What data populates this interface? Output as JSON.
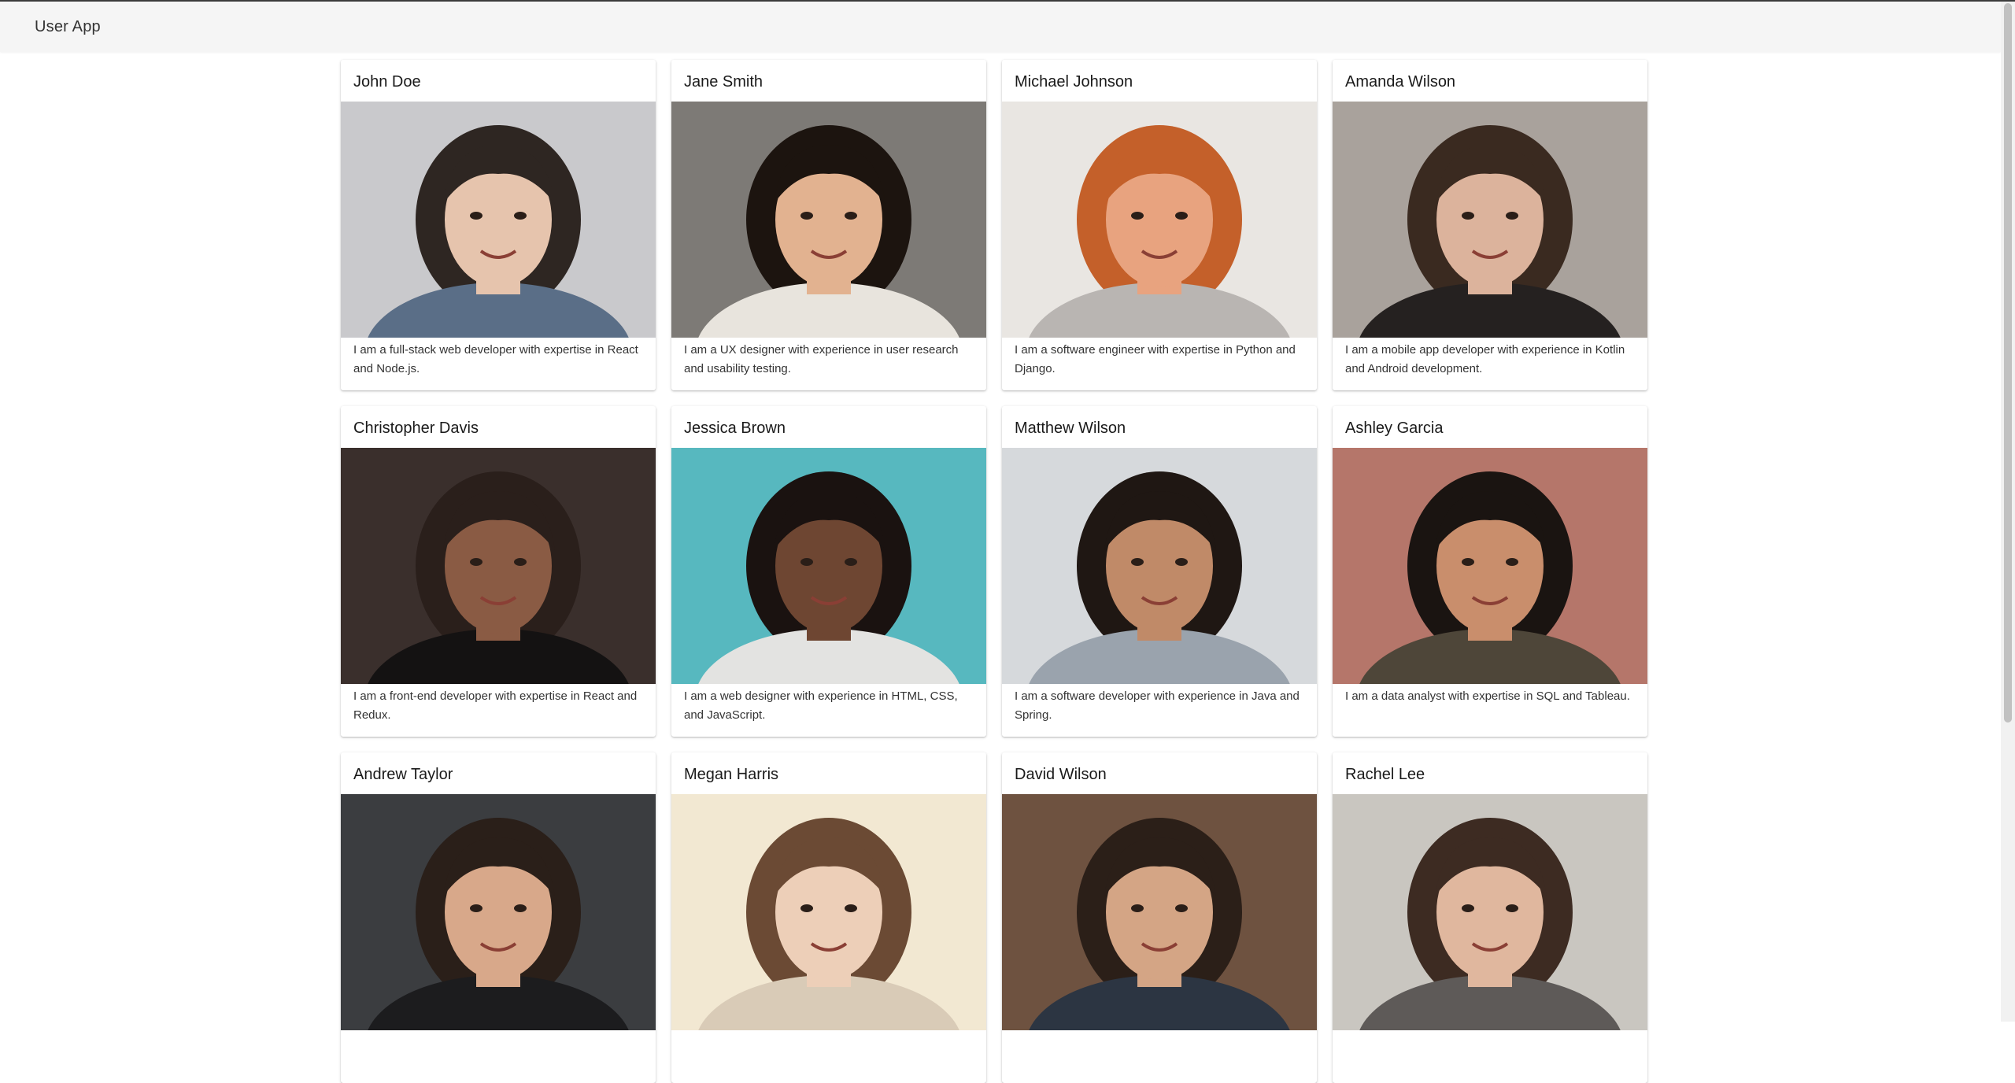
{
  "app": {
    "title": "User App"
  },
  "users": [
    {
      "name": "John Doe",
      "bio": "I am a full-stack web developer with expertise in React and Node.js.",
      "photo_bg": "#c9c9cc",
      "skin": "#e6c4ad",
      "hair": "#2e2622",
      "shirt": "#5a6e87"
    },
    {
      "name": "Jane Smith",
      "bio": "I am a UX designer with experience in user research and usability testing.",
      "photo_bg": "#7d7a76",
      "skin": "#e2b290",
      "hair": "#1c140f",
      "shirt": "#e8e4dd"
    },
    {
      "name": "Michael Johnson",
      "bio": "I am a software engineer with expertise in Python and Django.",
      "photo_bg": "#e9e6e2",
      "skin": "#e8a37f",
      "hair": "#c4602a",
      "shirt": "#b9b5b2"
    },
    {
      "name": "Amanda Wilson",
      "bio": "I am a mobile app developer with experience in Kotlin and Android development.",
      "photo_bg": "#a9a29c",
      "skin": "#dcb39c",
      "hair": "#3a2a20",
      "shirt": "#252120"
    },
    {
      "name": "Christopher Davis",
      "bio": "I am a front-end developer with expertise in React and Redux.",
      "photo_bg": "#3a2f2c",
      "skin": "#8a5b44",
      "hair": "#2a1f1b",
      "shirt": "#141212"
    },
    {
      "name": "Jessica Brown",
      "bio": "I am a web designer with experience in HTML, CSS, and JavaScript.",
      "photo_bg": "#57b8bf",
      "skin": "#6e4632",
      "hair": "#1a1210",
      "shirt": "#e3e3e1"
    },
    {
      "name": "Matthew Wilson",
      "bio": "I am a software developer with experience in Java and Spring.",
      "photo_bg": "#d6d9dc",
      "skin": "#c08a68",
      "hair": "#1f1713",
      "shirt": "#9aa3ad"
    },
    {
      "name": "Ashley Garcia",
      "bio": "I am a data analyst with expertise in SQL and Tableau.",
      "photo_bg": "#b5766a",
      "skin": "#c98e6c",
      "hair": "#1a1411",
      "shirt": "#4e4639"
    },
    {
      "name": "Andrew Taylor",
      "bio": "",
      "photo_bg": "#3b3d40",
      "skin": "#d8a88a",
      "hair": "#2a1f19",
      "shirt": "#1c1c1e"
    },
    {
      "name": "Megan Harris",
      "bio": "",
      "photo_bg": "#f2e8d2",
      "skin": "#edcfb8",
      "hair": "#6b4a34",
      "shirt": "#d9cbb7"
    },
    {
      "name": "David Wilson",
      "bio": "",
      "photo_bg": "#6e5240",
      "skin": "#d4a585",
      "hair": "#2b1f18",
      "shirt": "#2c3542"
    },
    {
      "name": "Rachel Lee",
      "bio": "",
      "photo_bg": "#c9c6c0",
      "skin": "#e0b79e",
      "hair": "#3d2b22",
      "shirt": "#5e5a58"
    }
  ]
}
